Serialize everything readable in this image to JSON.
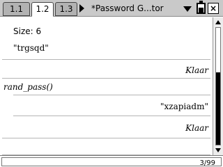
{
  "tabs": [
    {
      "label": "1.1",
      "active": false
    },
    {
      "label": "1.2",
      "active": true
    },
    {
      "label": "1.3",
      "active": false
    }
  ],
  "document_title": "*Password G...tor",
  "content": {
    "size_line": "Size: 6",
    "output1": "\"trgsqd\"",
    "status1": "Klaar",
    "command": "rand_pass()",
    "output2": "\"xzapiadm\"",
    "status2": "Klaar"
  },
  "scroll_position": 0.62,
  "status_bar": {
    "page_counter": "3/99"
  },
  "icons": [
    "battery-icon",
    "close-icon",
    "nav-arrow-right-icon",
    "dropdown-caret-icon",
    "scroll-up-icon",
    "scroll-down-icon"
  ]
}
